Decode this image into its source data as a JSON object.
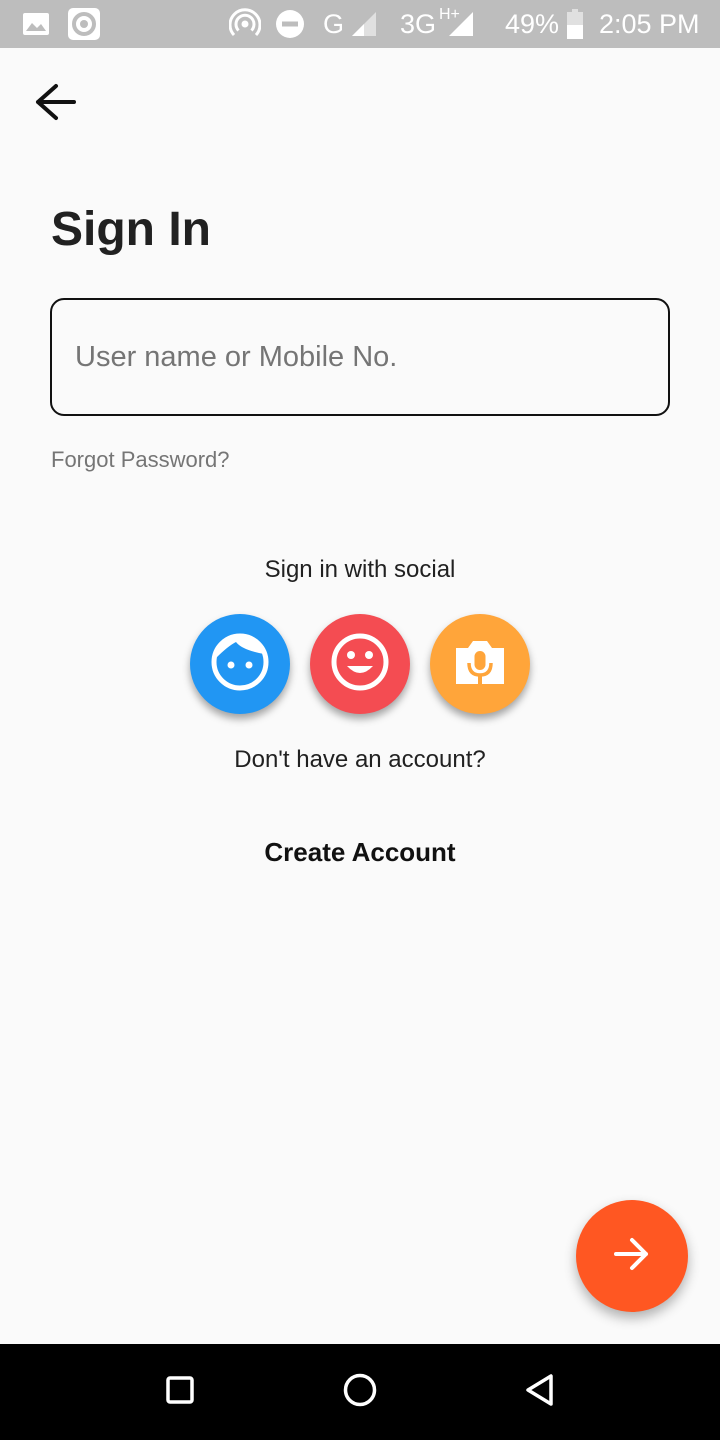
{
  "status_bar": {
    "icons": [
      "image-icon",
      "sync-icon",
      "hotspot-icon",
      "do-not-disturb-icon",
      "signal-icon",
      "signal-icon",
      "battery-icon"
    ],
    "network_g": "G",
    "network_3g": "3G",
    "network_hplus": "H+",
    "battery": "49%",
    "time": "2:05 PM"
  },
  "header": {
    "back_icon": "arrow-back-icon"
  },
  "page": {
    "title": "Sign In"
  },
  "form": {
    "username_placeholder": "User name or Mobile No.",
    "username_value": "",
    "forgot_password": "Forgot Password?"
  },
  "social": {
    "label": "Sign in with social",
    "buttons": [
      {
        "icon": "face-icon",
        "color": "#2196f3"
      },
      {
        "icon": "smiley-icon",
        "color": "#f44c52"
      },
      {
        "icon": "camera-mic-icon",
        "color": "#ffa53a"
      }
    ]
  },
  "account": {
    "prompt": "Don't have an account?",
    "create_label": "Create Account"
  },
  "fab": {
    "icon": "arrow-forward-icon",
    "color": "#ff5722"
  },
  "nav_bar": {
    "icons": [
      "recents-icon",
      "home-icon",
      "back-icon"
    ]
  }
}
